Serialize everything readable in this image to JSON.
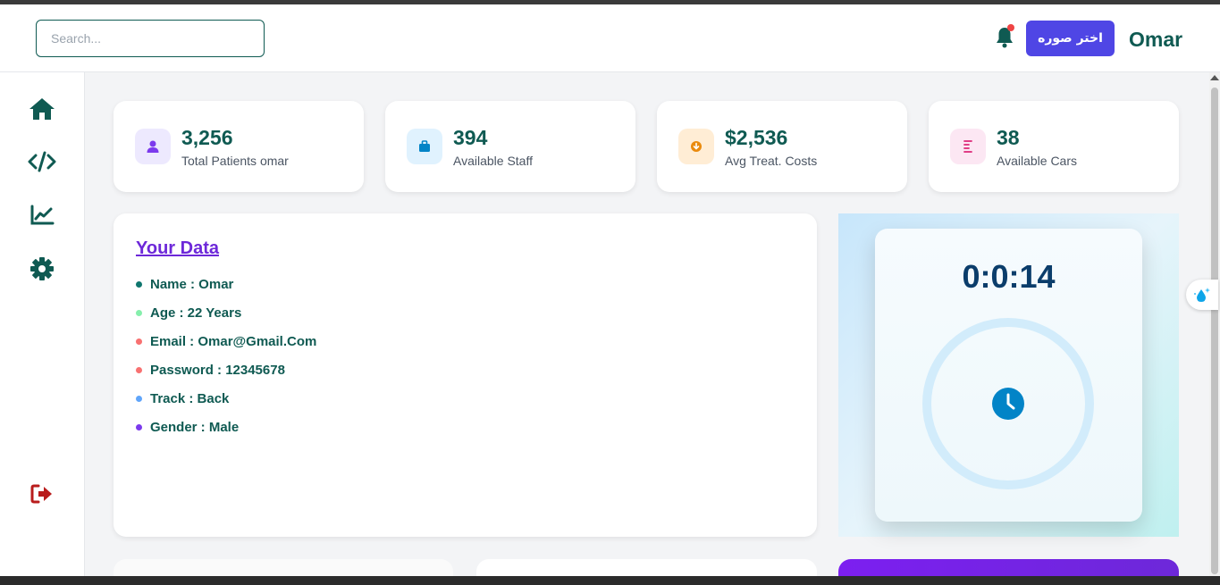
{
  "header": {
    "search_placeholder": "Search...",
    "pick_image_label": "اختر صوره",
    "username": "Omar"
  },
  "sidebar": {
    "items": [
      {
        "name": "home",
        "icon": "home-icon"
      },
      {
        "name": "code",
        "icon": "code-icon"
      },
      {
        "name": "chart",
        "icon": "chart-line-icon"
      },
      {
        "name": "settings",
        "icon": "gear-icon"
      }
    ],
    "logout_icon": "logout-icon"
  },
  "stats": [
    {
      "value": "3,256",
      "label": "Total Patients omar",
      "icon": "user-icon",
      "color": "#7c3aed",
      "bg": "#ede9fe"
    },
    {
      "value": "394",
      "label": "Available Staff",
      "icon": "briefcase-icon",
      "color": "#0284c7",
      "bg": "#e0f2fe"
    },
    {
      "value": "$2,536",
      "label": "Avg Treat. Costs",
      "icon": "download-circle-icon",
      "color": "#ea8a0c",
      "bg": "#ffedd5"
    },
    {
      "value": "38",
      "label": "Available Cars",
      "icon": "list-icon",
      "color": "#db2777",
      "bg": "#fce7f3"
    }
  ],
  "your_data": {
    "title": "Your Data",
    "items": [
      {
        "text": "Name : Omar",
        "bullet_color": "#0f766e"
      },
      {
        "text": "Age : 22 Years",
        "bullet_color": "#86efac"
      },
      {
        "text": "Email : Omar@Gmail.Com",
        "bullet_color": "#f87171"
      },
      {
        "text": "Password : 12345678",
        "bullet_color": "#f87171"
      },
      {
        "text": "Track : Back",
        "bullet_color": "#60a5fa"
      },
      {
        "text": "Gender : Male",
        "bullet_color": "#7c3aed"
      }
    ]
  },
  "timer": {
    "time": "0:0:14",
    "icon": "clock-icon"
  },
  "colors": {
    "brand": "#0f5a52",
    "accent": "#4f46e5",
    "title_purple": "#6d28d9"
  }
}
